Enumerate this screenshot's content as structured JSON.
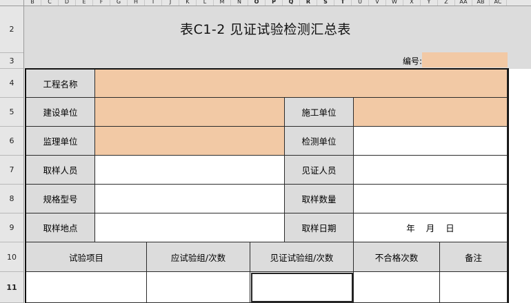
{
  "columns": [
    "B",
    "C",
    "D",
    "E",
    "F",
    "G",
    "H",
    "I",
    "J",
    "K",
    "L",
    "M",
    "N",
    "O",
    "P",
    "Q",
    "R",
    "S",
    "T",
    "U",
    "V",
    "W",
    "X",
    "Y",
    "Z",
    "AA",
    "AB",
    "AC"
  ],
  "rows": [
    "2",
    "3",
    "4",
    "5",
    "6",
    "7",
    "8",
    "9",
    "10",
    "11"
  ],
  "title": "表C1-2 见证试验检测汇总表",
  "number_label": "编号:",
  "number_value": "",
  "form": {
    "project_name_label": "工程名称",
    "construction_unit_label": "建设单位",
    "builder_unit_label": "施工单位",
    "supervision_unit_label": "监理单位",
    "testing_unit_label": "检测单位",
    "sampler_label": "取样人员",
    "witness_label": "见证人员",
    "spec_model_label": "规格型号",
    "sample_qty_label": "取样数量",
    "sample_location_label": "取样地点",
    "sample_date_label": "取样日期",
    "date_year": "年",
    "date_month": "月",
    "date_day": "日"
  },
  "table": {
    "headers": [
      "试验项目",
      "应试验组/次数",
      "见证试验组/次数",
      "不合格次数",
      "备注"
    ]
  },
  "colors": {
    "input_fill": "#f2c9a5",
    "label_fill": "#dcdcdc"
  }
}
